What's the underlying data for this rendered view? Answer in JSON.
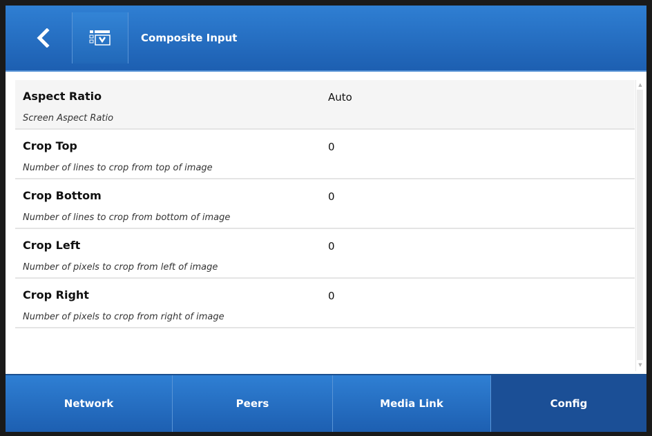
{
  "header": {
    "title": "Composite Input",
    "back_icon": "chevron-left-icon",
    "menu_icon": "list-download-icon"
  },
  "settings": [
    {
      "label": "Aspect Ratio",
      "value": "Auto",
      "description": "Screen Aspect Ratio"
    },
    {
      "label": "Crop Top",
      "value": "0",
      "description": "Number of lines to crop from top of image"
    },
    {
      "label": "Crop Bottom",
      "value": "0",
      "description": "Number of lines to crop from bottom of image"
    },
    {
      "label": "Crop Left",
      "value": "0",
      "description": "Number of pixels to crop from left of image"
    },
    {
      "label": "Crop Right",
      "value": "0",
      "description": "Number of pixels to crop from right of image"
    }
  ],
  "tabs": [
    {
      "label": "Network"
    },
    {
      "label": "Peers"
    },
    {
      "label": "Media Link"
    },
    {
      "label": "Config",
      "active": true
    }
  ],
  "colors": {
    "header_blue": "#2670c4",
    "active_tab": "#1b4f96"
  }
}
